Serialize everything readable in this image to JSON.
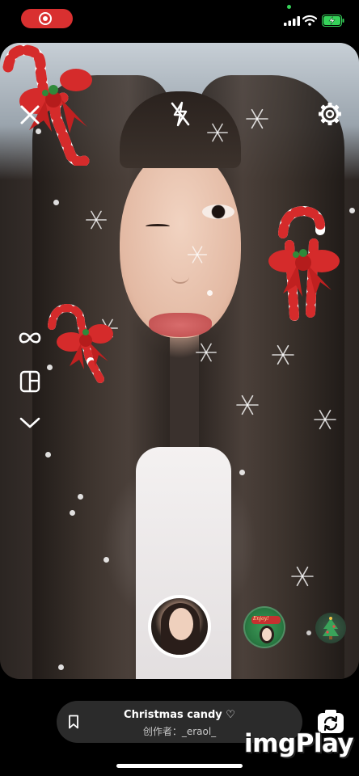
{
  "effect": {
    "name": "Christmas candy ♡",
    "creator": "创作者：_eraol_"
  },
  "effect_thumbnail_text": "Enjoy!",
  "watermark": "imgPlay",
  "icons": {
    "close": "close-icon",
    "flash": "flash-off-icon",
    "settings": "gear-icon",
    "boomerang": "infinity-icon",
    "layout": "layout-icon",
    "more": "chevron-down-icon",
    "bookmark": "bookmark-icon",
    "flip": "flip-camera-icon"
  },
  "colors": {
    "recording": "#d93030",
    "candy_red": "#d52b2b",
    "pill_bg": "#2b2b2b",
    "battery": "#36d35a"
  }
}
